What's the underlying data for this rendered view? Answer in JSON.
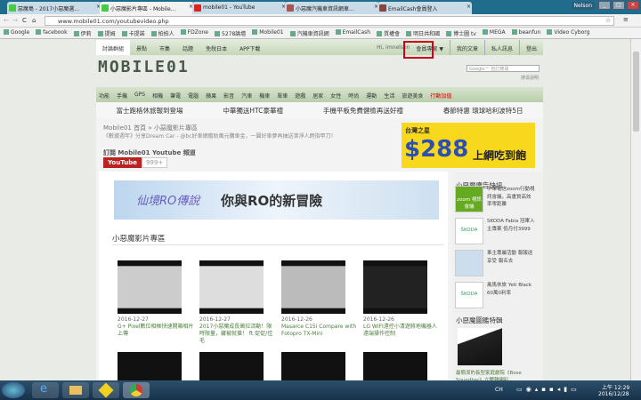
{
  "browser": {
    "tabs": [
      "惡魔島 - 2017小惡魔選...",
      "小惡魔影片專區 - Mobile...",
      "mobile01 - YouTube",
      "小惡魔汽機車資訊網車...",
      "EmailCash會員登入"
    ],
    "user": "Nelson",
    "url": "www.mobile01.com/youtubevideo.php",
    "bookmarks": [
      "Google",
      "facebook",
      "伊莉",
      "提姆",
      "卡提諾",
      "拍拍人",
      "FDZone",
      "5278論壇",
      "Mobile01",
      "汽機車資訊網",
      "EmailCash",
      "質權會",
      "明日共和國",
      "博士圖 tv",
      "MEGA",
      "beanfun",
      "Video Cyborg"
    ]
  },
  "topnav": {
    "left": [
      "討論群組",
      "景點",
      "市集",
      "話題",
      "免稅日本",
      "APP下載"
    ],
    "greeting": "Hi, imnelson",
    "right": [
      "我的文章",
      "私人訊息",
      "登出"
    ],
    "member": "會員專案 ▼"
  },
  "logo": "MOBILE01",
  "search": {
    "placeholder": "Google™ 自訂搜尋",
    "help": "搜尋說明"
  },
  "categories": [
    "功能",
    "手機",
    "GPS",
    "相機",
    "筆電",
    "電腦",
    "蘋果",
    "影音",
    "汽車",
    "機車",
    "單車",
    "遊戲",
    "居家",
    "女性",
    "時尚",
    "運動",
    "生活",
    "旅遊美食",
    "行動加值"
  ],
  "promos": [
    "富士跑格休旅報到登場",
    "中華獨送HTC豪華禮",
    "手機平板免費健檢再送好禮",
    "春節特惠 環球哈利波特5日"
  ],
  "breadcrumb": "Mobile01 首頁 » 小惡魔影片專區",
  "notice": "《數據週年》分享Dream Car - @bc好車網贈助萬元購車金，一圓好車夢再抽送潔淨人跨指甲刀！",
  "subscribe": {
    "label": "訂閱 Mobile01 Youtube 頻道",
    "button": "YouTube",
    "count": "999+"
  },
  "ad_top": {
    "brand": "台灣之星",
    "price": "$288",
    "text": "上網吃到飽"
  },
  "banner": {
    "title": "仙境RO傳說",
    "slogan": "你與RO的新冒險"
  },
  "section_title": "小惡魔影片專區",
  "videos": [
    {
      "date": "2016-12-27",
      "title": "G+ Pixel數位相框快速開箱相片上傳"
    },
    {
      "date": "2016-12-27",
      "title": "2017小惡魔成長徵拉活動！限時限量，藏被就搶！ ft.促促/佳毛"
    },
    {
      "date": "2016-12-26",
      "title": "Masarce C15i Compare with Fotopro TX-Mini"
    },
    {
      "date": "2016-12-26",
      "title": "LG WIFI遠控小清遊將地機器人遠端操作控制"
    }
  ],
  "sidebar": {
    "title": "小惡魔廣告快訊",
    "ads": [
      {
        "img": "zoom 視訊會議",
        "text": "中華電信zoom行動視訊會議，高畫質高效率零距離"
      },
      {
        "img": "ŠKODA",
        "text": "SKODA Fabia 冠軍入主專案 低月付3999"
      },
      {
        "img": "",
        "text": "車主專屬活動 報報送享受 報名去"
      },
      {
        "img": "ŠKODA",
        "text": "風馬休旅 Yeti Black 60萬0利率"
      }
    ],
    "title2": "小惡魔圖鑑特輯",
    "caption": "最簡潔的長型家庭劇院《Bose Soundbar》立體聲喇叭"
  },
  "taskbar": {
    "lang": "CH",
    "time": "上午 12:29",
    "date": "2016/12/28"
  }
}
